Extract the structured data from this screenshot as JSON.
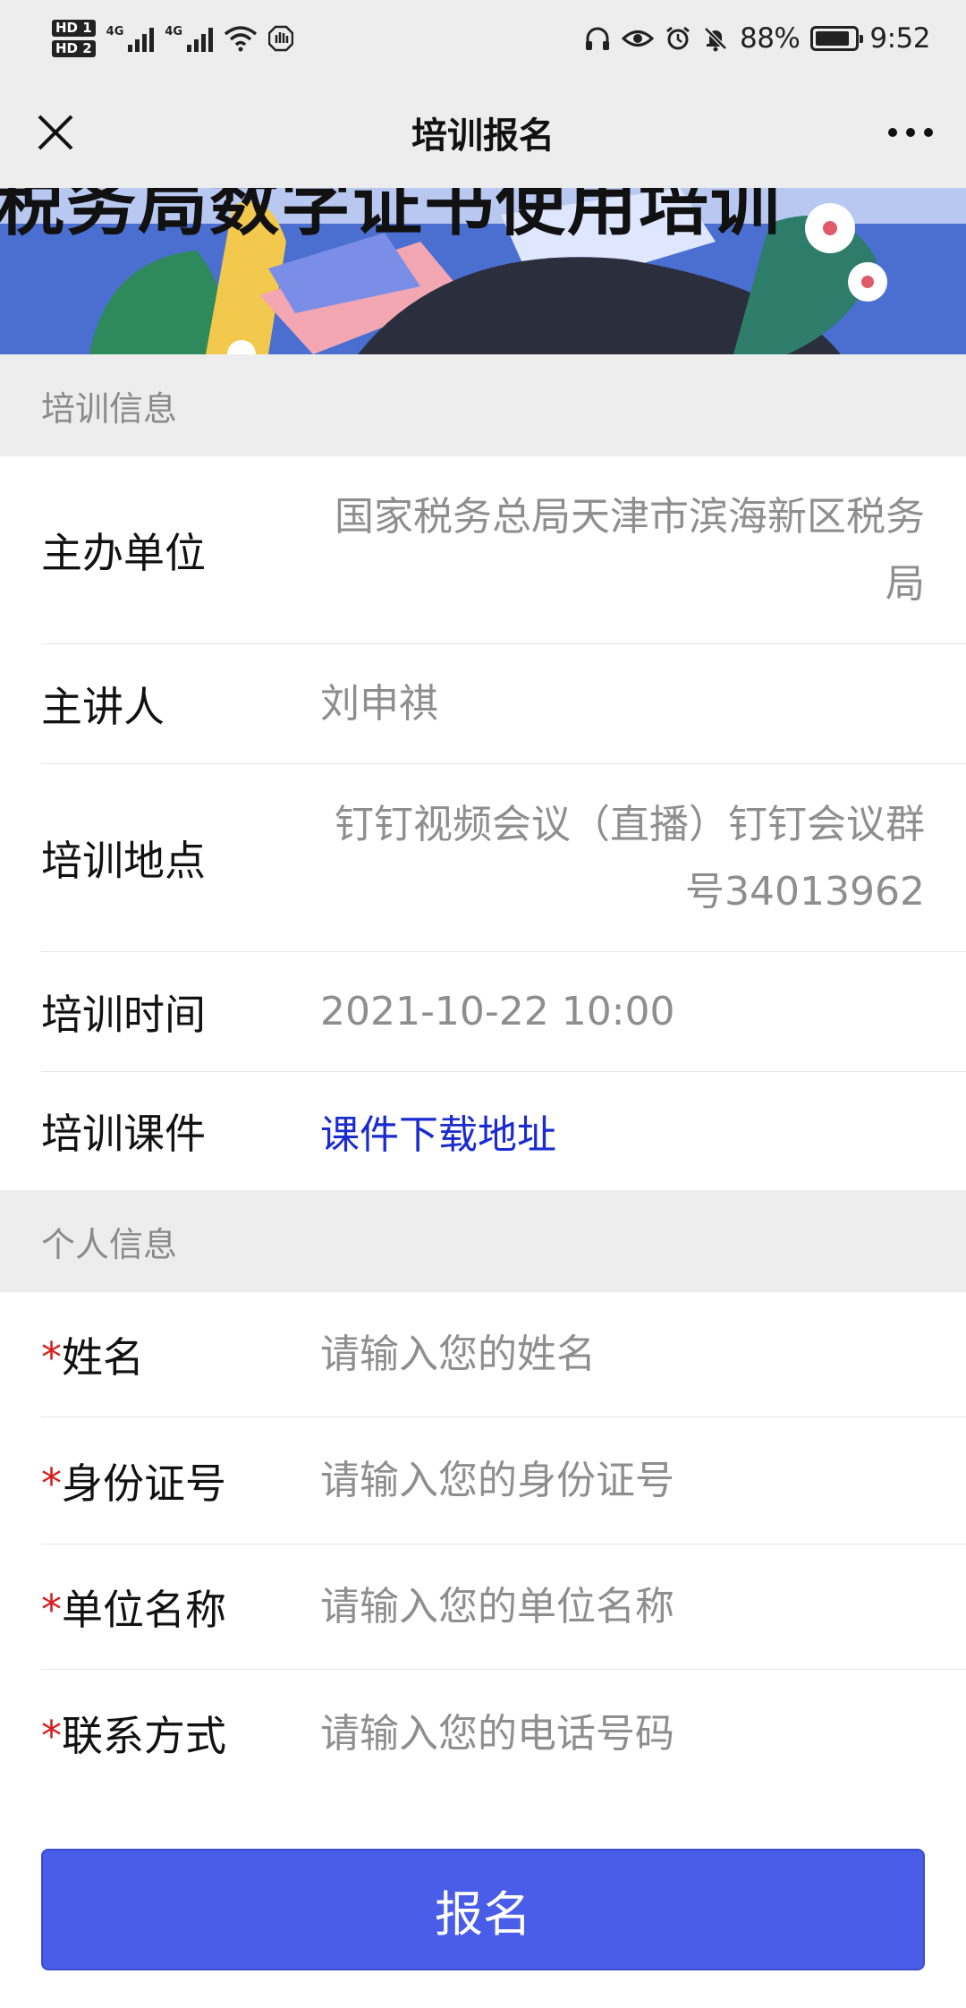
{
  "status_bar": {
    "hd1": "HD 1",
    "hd2": "HD 2",
    "net1": "4G",
    "net2": "4G",
    "battery_pct": "88%",
    "battery_level": 0.88,
    "time": "9:52"
  },
  "nav": {
    "title": "培训报名",
    "close_icon": "close-icon",
    "more_icon": "more-icon"
  },
  "banner": {
    "title": "税务局数字证书使用培训"
  },
  "sections": {
    "training_info": "培训信息",
    "personal_info": "个人信息"
  },
  "training": {
    "organizer_label": "主办单位",
    "organizer_value": "国家税务总局天津市滨海新区税务局",
    "speaker_label": "主讲人",
    "speaker_value": "刘申祺",
    "location_label": "培训地点",
    "location_value": "钉钉视频会议（直播）钉钉会议群号34013962",
    "time_label": "培训时间",
    "time_value": "2021-10-22 10:00",
    "courseware_label": "培训课件",
    "courseware_link": "课件下载地址"
  },
  "form": {
    "required_mark": "*",
    "name_label": "姓名",
    "name_placeholder": "请输入您的姓名",
    "id_label": "身份证号",
    "id_placeholder": "请输入您的身份证号",
    "org_label": "单位名称",
    "org_placeholder": "请输入您的单位名称",
    "contact_label": "联系方式",
    "contact_placeholder": "请输入您的电话号码",
    "submit_label": "报名"
  },
  "colors": {
    "accent": "#4a5de8",
    "link": "#1a2bd0",
    "required": "#d81e1e"
  }
}
